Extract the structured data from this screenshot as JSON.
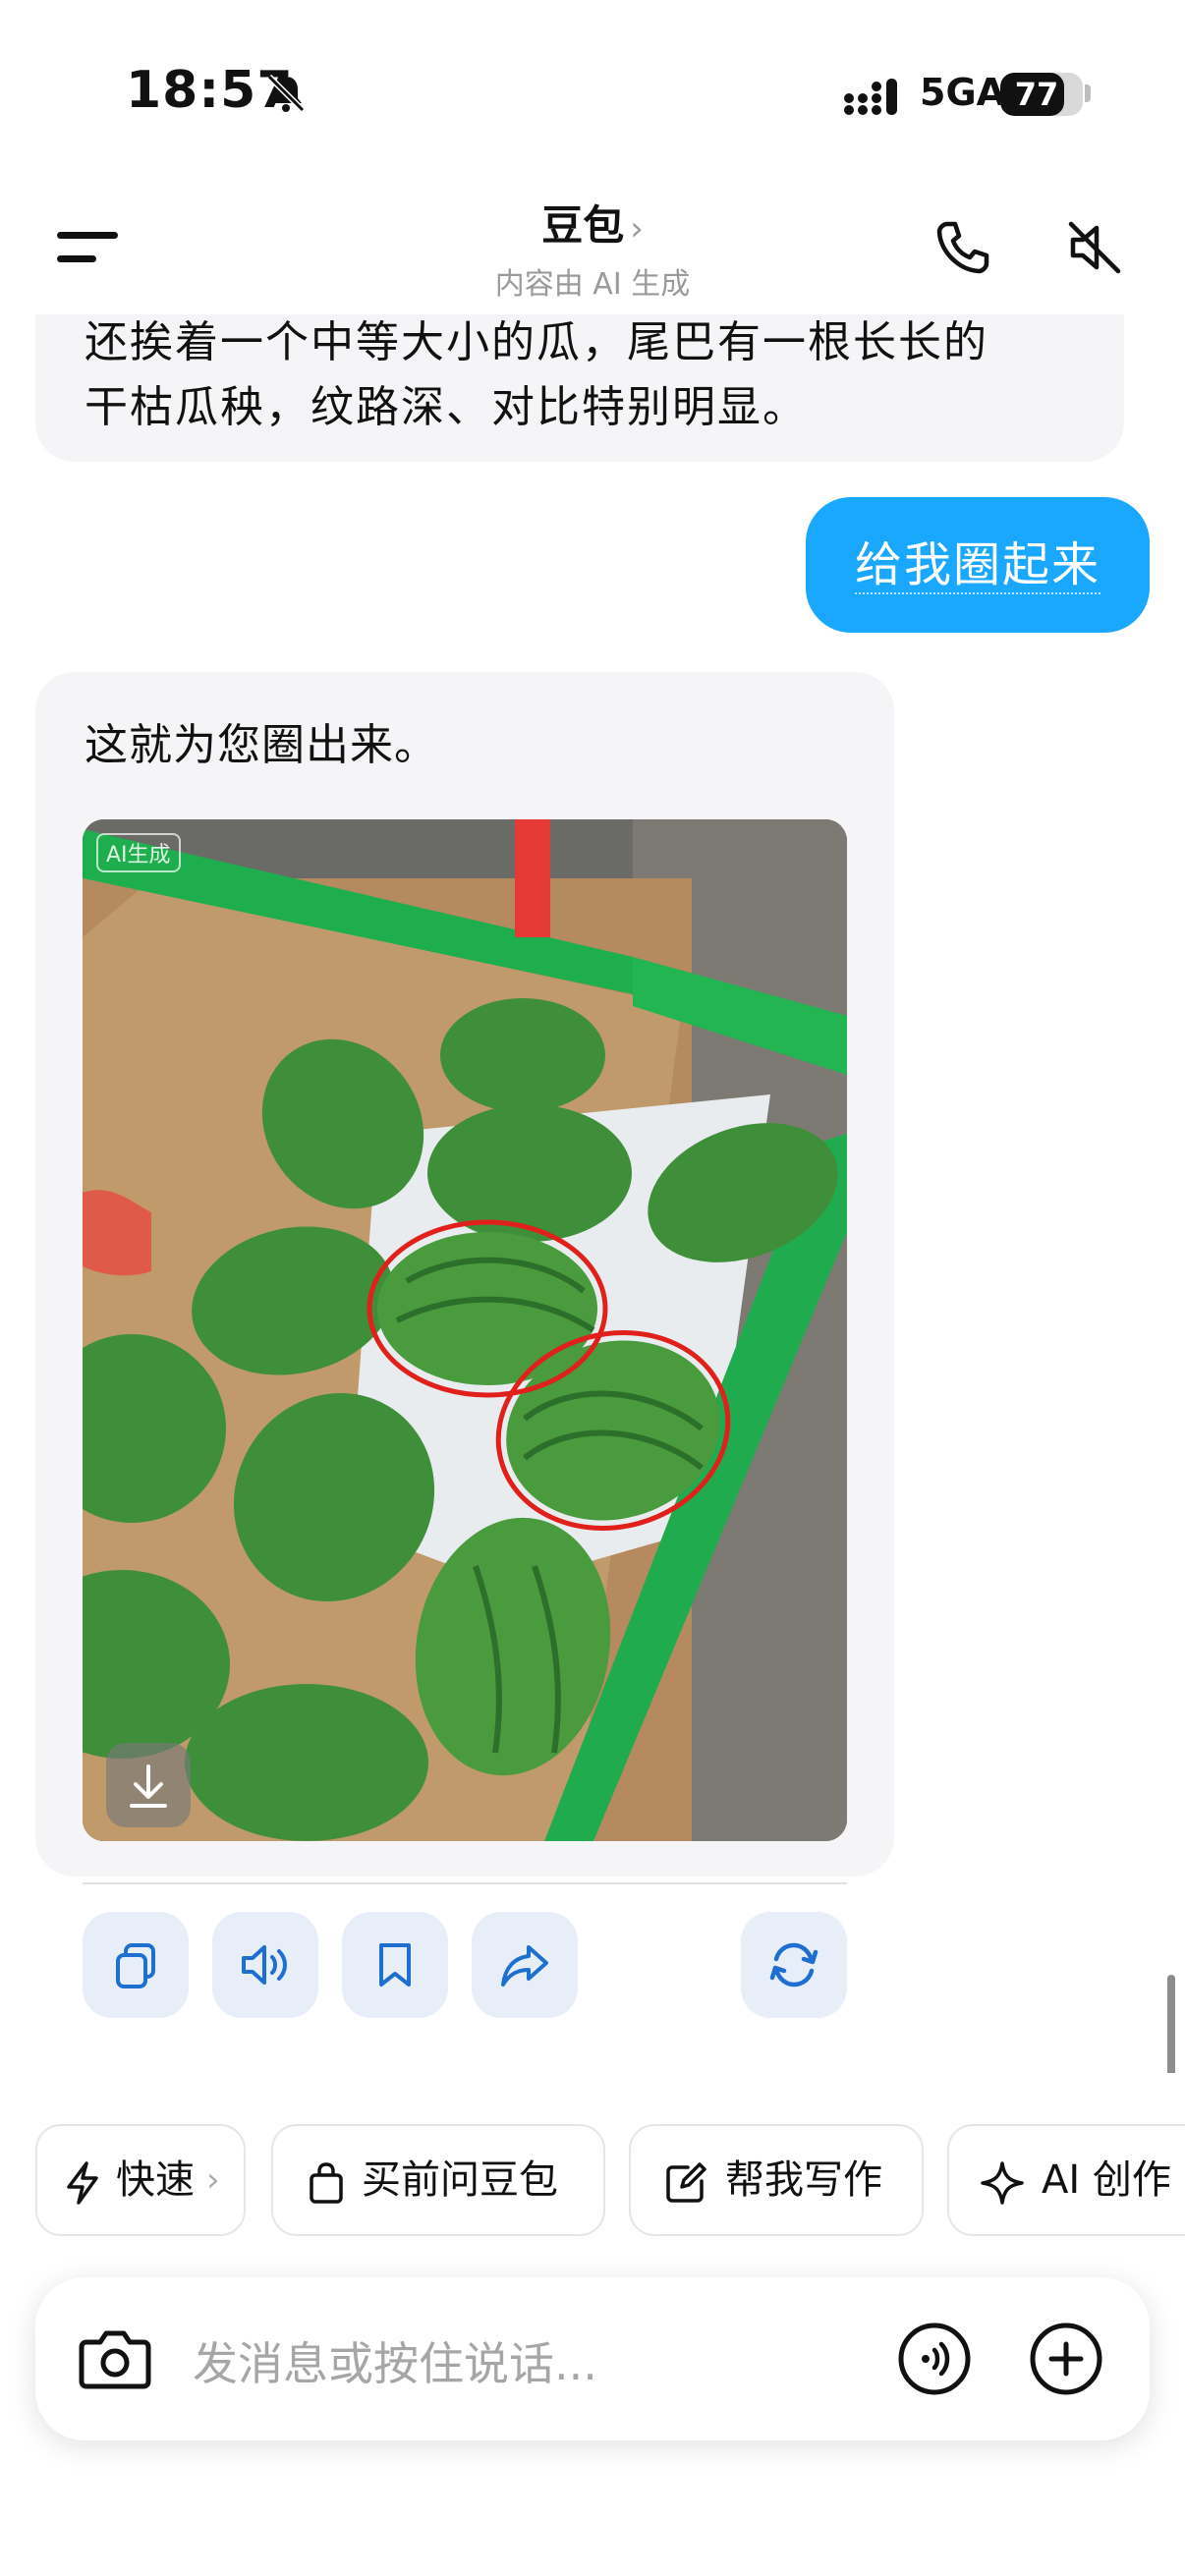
{
  "status_bar": {
    "time": "18:57",
    "network": "5GA",
    "battery": "77",
    "battery_level": 0.77
  },
  "header": {
    "title": "豆包",
    "title_chevron": "›",
    "subtitle": "内容由 AI 生成"
  },
  "chat": {
    "previous_message": {
      "lines": [
        "还挨着一个中等大小的瓜，尾巴有一根长长的",
        "干枯瓜秧，纹路深、对比特别明显。"
      ]
    },
    "user_message": "给我圈起来",
    "assistant_message": {
      "text": "这就为您圈出来。",
      "image_badge": "AI生成"
    }
  },
  "icons": [
    "menu-icon",
    "phone-icon",
    "speaker-mute-icon",
    "bell-mute-icon",
    "signal-icon",
    "download-icon",
    "copy-icon",
    "speaker-icon",
    "bookmark-icon",
    "share-icon",
    "refresh-icon",
    "lightning-icon",
    "shopping-bag-icon",
    "edit-icon",
    "sparkle-icon",
    "camera-icon",
    "voice-icon",
    "plus-icon"
  ],
  "chips": [
    {
      "label": "快速",
      "suffix": "›"
    },
    {
      "label": "买前问豆包"
    },
    {
      "label": "帮我写作"
    },
    {
      "label": "AI 创作"
    }
  ],
  "input": {
    "placeholder": "发消息或按住说话..."
  },
  "colors": {
    "accent": "#1aa7ff",
    "bubble_bg": "#f5f5f7",
    "action_bg": "#e7eef8",
    "action_icon": "#1f6fd1",
    "circle_mark": "#e0201b"
  }
}
